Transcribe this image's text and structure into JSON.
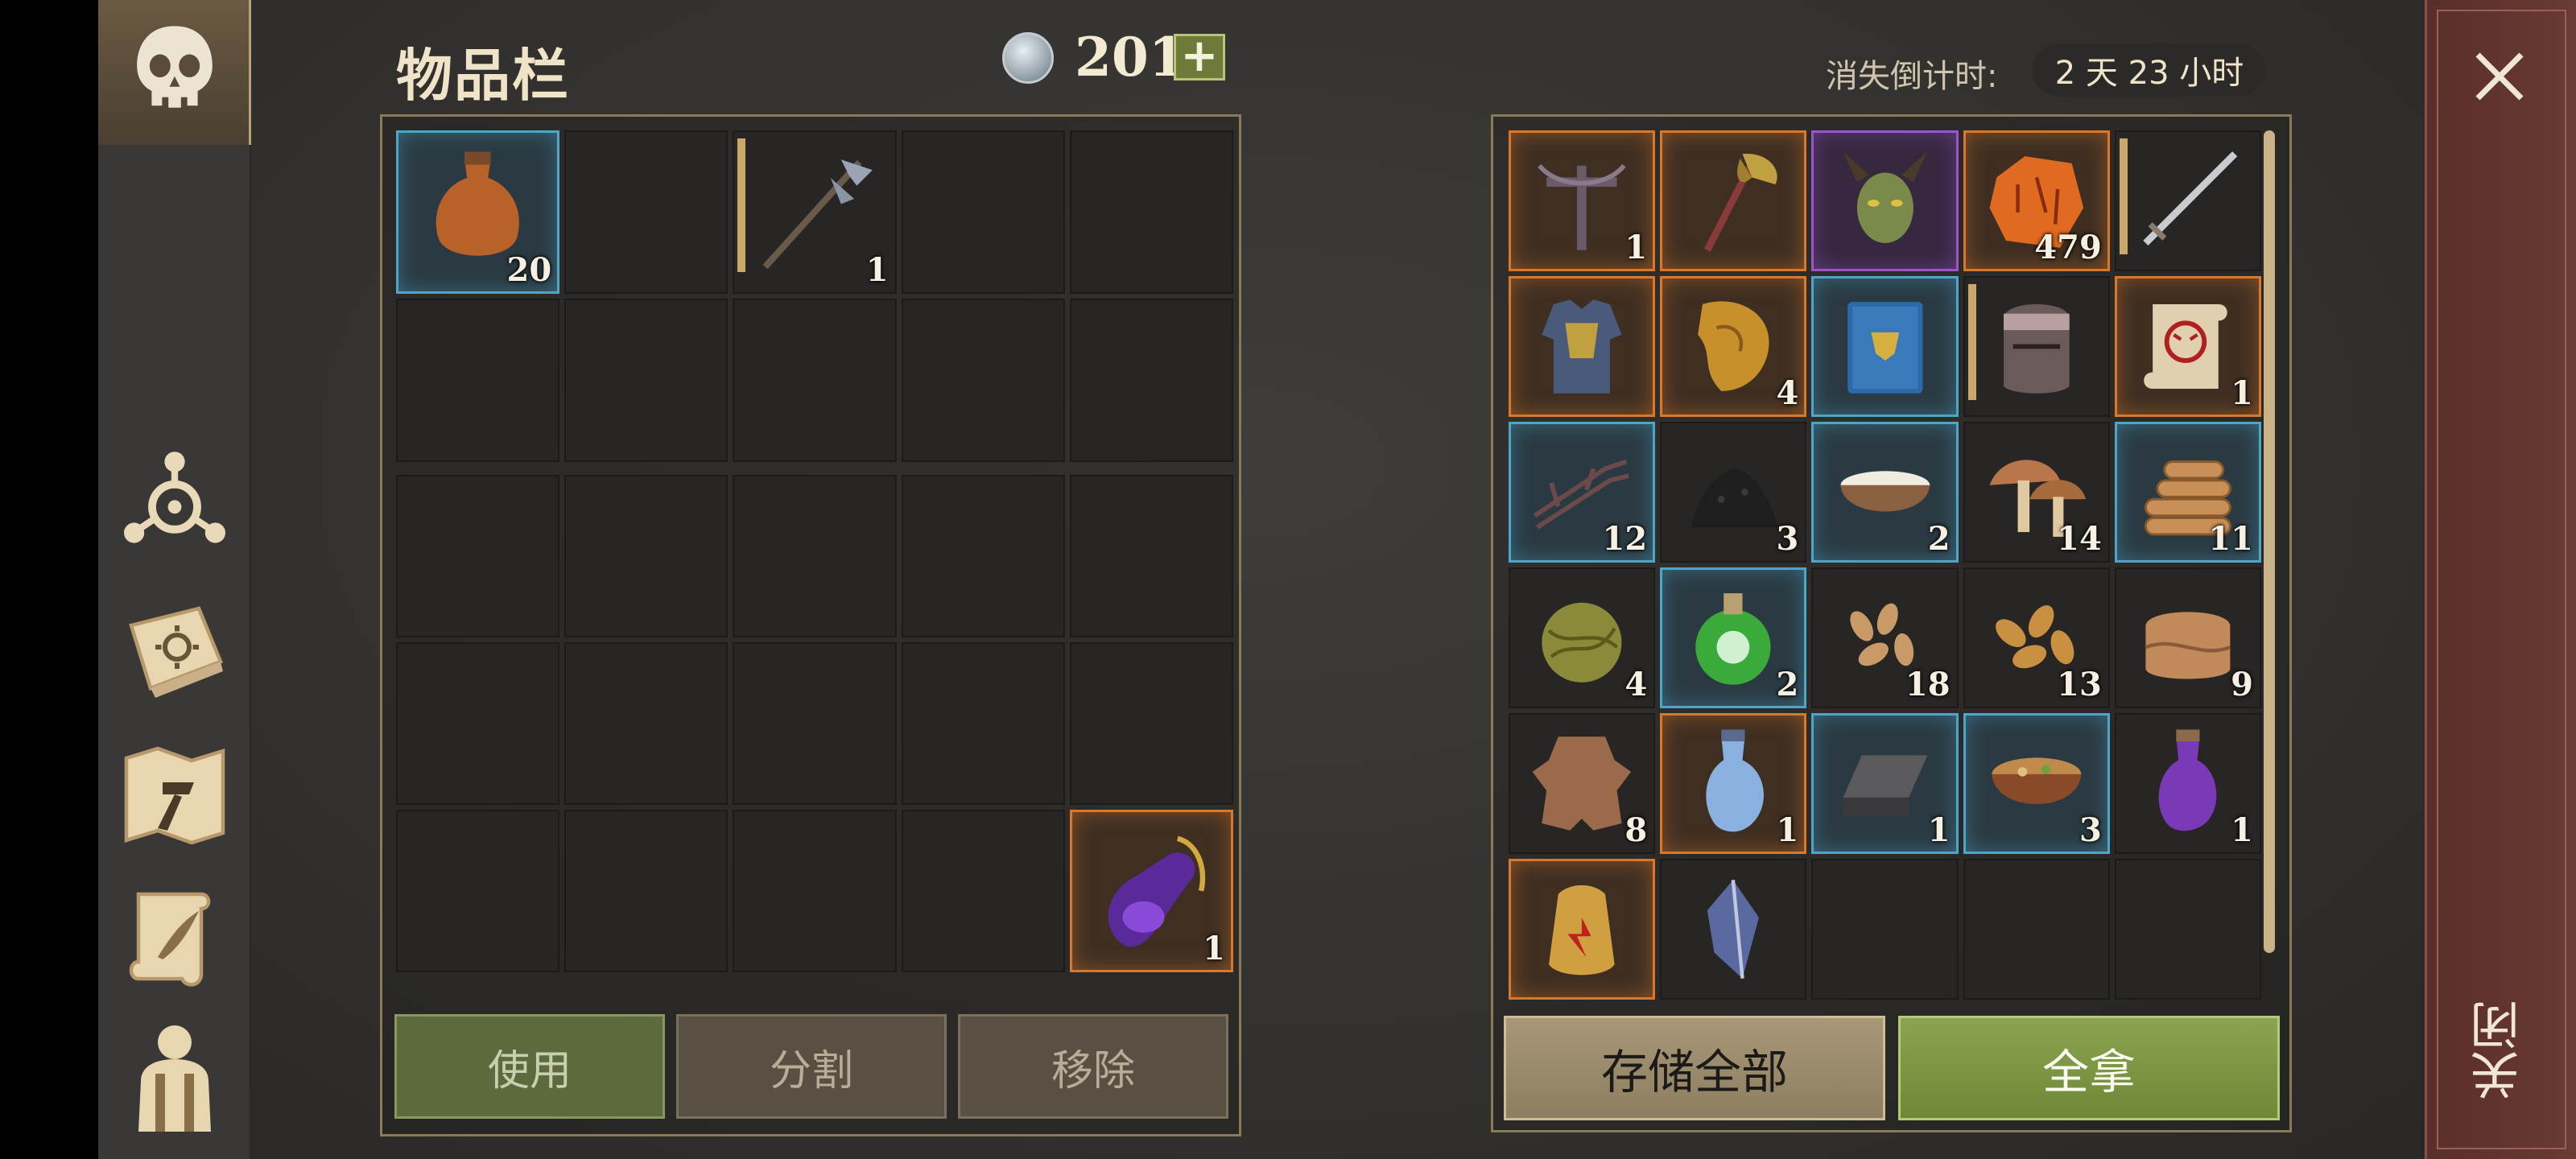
{
  "header": {
    "title": "物品栏",
    "currency": "201",
    "add_label": "+",
    "countdown_label": "消失倒计时:",
    "countdown_value": "2 天 23 小时"
  },
  "close": {
    "label": "关闭"
  },
  "inventory": {
    "top_rows": [
      [
        {
          "icon": "gourd-flask-icon",
          "rarity": "blue",
          "qty": "20"
        },
        {
          "icon": "",
          "rarity": "",
          "qty": ""
        },
        {
          "icon": "halberd-icon",
          "rarity": "",
          "qty": "1",
          "durability": true
        },
        {
          "icon": "",
          "rarity": "",
          "qty": ""
        },
        {
          "icon": "",
          "rarity": "",
          "qty": ""
        }
      ],
      [
        {
          "icon": "",
          "rarity": "",
          "qty": ""
        },
        {
          "icon": "",
          "rarity": "",
          "qty": ""
        },
        {
          "icon": "",
          "rarity": "",
          "qty": ""
        },
        {
          "icon": "",
          "rarity": "",
          "qty": ""
        },
        {
          "icon": "",
          "rarity": "",
          "qty": ""
        }
      ]
    ],
    "bottom_rows": [
      [
        {
          "icon": "",
          "rarity": "",
          "qty": ""
        },
        {
          "icon": "",
          "rarity": "",
          "qty": ""
        },
        {
          "icon": "",
          "rarity": "",
          "qty": ""
        },
        {
          "icon": "",
          "rarity": "",
          "qty": ""
        },
        {
          "icon": "",
          "rarity": "",
          "qty": ""
        }
      ],
      [
        {
          "icon": "",
          "rarity": "",
          "qty": ""
        },
        {
          "icon": "",
          "rarity": "",
          "qty": ""
        },
        {
          "icon": "",
          "rarity": "",
          "qty": ""
        },
        {
          "icon": "",
          "rarity": "",
          "qty": ""
        },
        {
          "icon": "",
          "rarity": "",
          "qty": ""
        }
      ],
      [
        {
          "icon": "",
          "rarity": "",
          "qty": ""
        },
        {
          "icon": "",
          "rarity": "",
          "qty": ""
        },
        {
          "icon": "",
          "rarity": "",
          "qty": ""
        },
        {
          "icon": "",
          "rarity": "",
          "qty": ""
        },
        {
          "icon": "purple-potion-necklace-icon",
          "rarity": "orange",
          "qty": "1"
        }
      ]
    ],
    "buttons": {
      "use": "使用",
      "split": "分割",
      "remove": "移除"
    }
  },
  "storage": {
    "rows": [
      [
        {
          "icon": "crossbow-icon",
          "rarity": "orange",
          "qty": "1"
        },
        {
          "icon": "axe-icon",
          "rarity": "orange",
          "qty": ""
        },
        {
          "icon": "demon-head-icon",
          "rarity": "purple",
          "qty": ""
        },
        {
          "icon": "rune-stone-icon",
          "rarity": "orange",
          "qty": "479"
        },
        {
          "icon": "sword-icon",
          "rarity": "",
          "qty": "",
          "durability": true
        }
      ],
      [
        {
          "icon": "armor-chest-icon",
          "rarity": "orange",
          "qty": ""
        },
        {
          "icon": "parchment-scrap-icon",
          "rarity": "orange",
          "qty": "4"
        },
        {
          "icon": "blue-book-icon",
          "rarity": "blue",
          "qty": ""
        },
        {
          "icon": "knight-helmet-icon",
          "rarity": "",
          "qty": "",
          "durability": true
        },
        {
          "icon": "wolf-scroll-icon",
          "rarity": "orange",
          "qty": "1"
        }
      ],
      [
        {
          "icon": "twig-bundle-icon",
          "rarity": "blue",
          "qty": "12"
        },
        {
          "icon": "coal-pile-icon",
          "rarity": "",
          "qty": "3"
        },
        {
          "icon": "bowl-of-flour-icon",
          "rarity": "blue",
          "qty": "2"
        },
        {
          "icon": "mushroom-icon",
          "rarity": "",
          "qty": "14"
        },
        {
          "icon": "log-pile-icon",
          "rarity": "blue",
          "qty": "11"
        }
      ],
      [
        {
          "icon": "fiber-ball-icon",
          "rarity": "",
          "qty": "4"
        },
        {
          "icon": "green-poison-flask-icon",
          "rarity": "blue",
          "qty": "2"
        },
        {
          "icon": "seeds-icon",
          "rarity": "",
          "qty": "18"
        },
        {
          "icon": "almonds-icon",
          "rarity": "",
          "qty": "13"
        },
        {
          "icon": "cloth-roll-icon",
          "rarity": "",
          "qty": "9"
        }
      ],
      [
        {
          "icon": "leather-hide-icon",
          "rarity": "",
          "qty": "8"
        },
        {
          "icon": "blue-vial-icon",
          "rarity": "orange",
          "qty": "1"
        },
        {
          "icon": "iron-ingot-icon",
          "rarity": "blue",
          "qty": "1"
        },
        {
          "icon": "stew-bowl-icon",
          "rarity": "blue",
          "qty": "3"
        },
        {
          "icon": "purple-potion-icon",
          "rarity": "",
          "qty": "1"
        }
      ],
      [
        {
          "icon": "fire-pouch-icon",
          "rarity": "orange",
          "qty": ""
        },
        {
          "icon": "crystal-shard-icon",
          "rarity": "",
          "qty": ""
        },
        {
          "icon": "",
          "rarity": "",
          "qty": ""
        },
        {
          "icon": "",
          "rarity": "",
          "qty": ""
        },
        {
          "icon": "",
          "rarity": "",
          "qty": ""
        }
      ]
    ],
    "buttons": {
      "store_all": "存储全部",
      "take_all": "全拿"
    }
  },
  "rail": {
    "items": [
      {
        "icon": "skull-icon"
      },
      {
        "icon": "triskelion-icon"
      },
      {
        "icon": "sun-book-icon"
      },
      {
        "icon": "map-hammer-icon"
      },
      {
        "icon": "quill-scroll-icon"
      },
      {
        "icon": "character-backpack-icon"
      }
    ]
  }
}
